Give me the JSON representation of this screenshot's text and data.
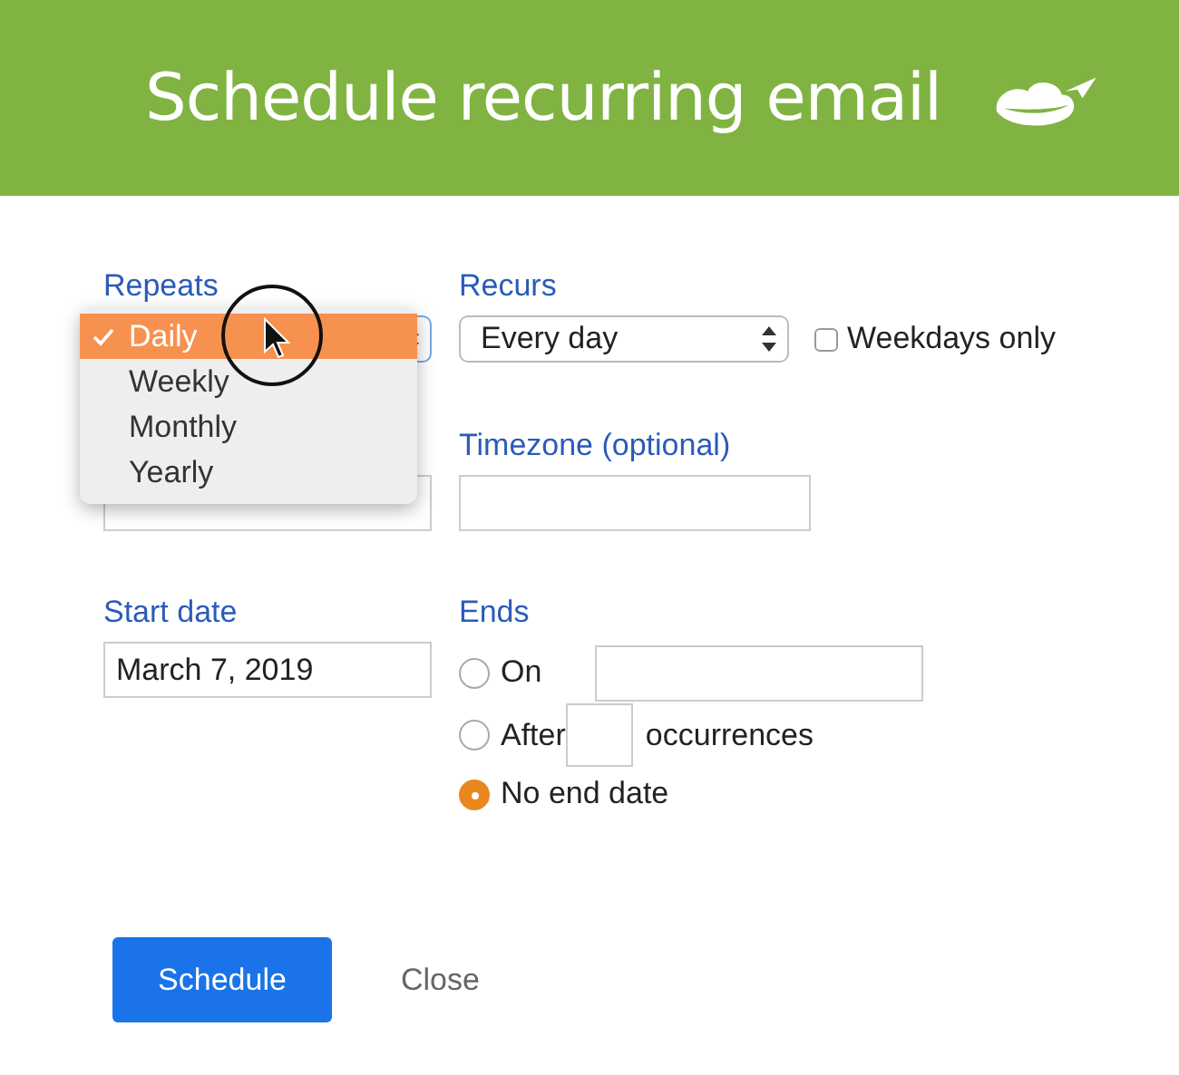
{
  "header": {
    "title": "Schedule recurring email"
  },
  "repeats": {
    "label": "Repeats",
    "open": true,
    "options": [
      {
        "label": "Daily",
        "selected": true
      },
      {
        "label": "Weekly",
        "selected": false
      },
      {
        "label": "Monthly",
        "selected": false
      },
      {
        "label": "Yearly",
        "selected": false
      }
    ]
  },
  "recurs": {
    "label": "Recurs",
    "value": "Every day",
    "weekdays_only": {
      "label": "Weekdays only",
      "checked": false
    }
  },
  "timezone": {
    "label": "Timezone (optional)"
  },
  "start_date": {
    "label": "Start date",
    "value": "March 7, 2019"
  },
  "ends": {
    "label": "Ends",
    "options": [
      {
        "label": "On",
        "kind": "date",
        "selected": false
      },
      {
        "label": "After",
        "kind": "count",
        "suffix": "occurrences",
        "selected": false
      },
      {
        "label": "No end date",
        "kind": "none",
        "selected": true
      }
    ]
  },
  "buttons": [
    {
      "label": "Schedule",
      "kind": "primary"
    },
    {
      "label": "Close",
      "kind": "secondary"
    }
  ]
}
